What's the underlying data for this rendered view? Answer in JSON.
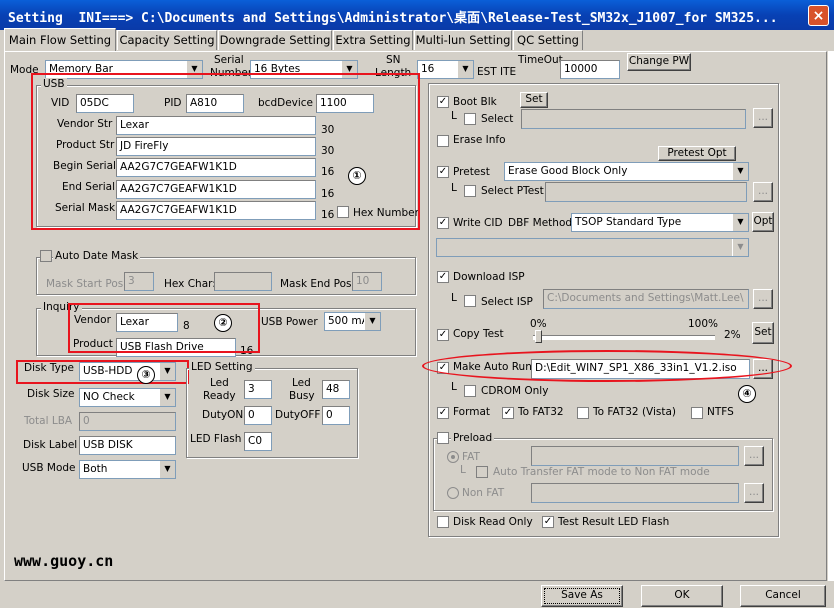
{
  "window": {
    "title": "Setting  INI===> C:\\Documents and Settings\\Administrator\\桌面\\Release-Test_SM32x_J1007_for SM325...",
    "close_label": "×"
  },
  "tabs": [
    "Main Flow Setting",
    "Capacity Setting",
    "Downgrade Setting",
    "Extra Setting",
    "Multi-lun Setting",
    "QC Setting"
  ],
  "top": {
    "mode_label": "Mode",
    "mode_value": "Memory Bar",
    "serial_label_1": "Serial",
    "serial_label_2": "Number",
    "serial_value": "16 Bytes",
    "sn_label_1": "SN",
    "sn_label_2": "Length",
    "sn_value": "16",
    "est_label": "EST ITEM",
    "timeout_label": "TimeOut",
    "timeout_value": "10000",
    "change_pw": "Change PW"
  },
  "usb": {
    "title": "USB",
    "vid_label": "VID",
    "vid": "05DC",
    "pid_label": "PID",
    "pid": "A810",
    "bcd_label": "bcdDevice",
    "bcd": "1100",
    "vendor_label": "Vendor Str",
    "vendor": "Lexar",
    "vendor_len": "30",
    "product_label": "Product Str",
    "product": "JD FireFly",
    "product_len": "30",
    "begin_label": "Begin Serial",
    "begin": "AA2G7C7GEAFW1K1D",
    "begin_len": "16",
    "end_label": "End Serial",
    "end": "AA2G7C7GEAFW1K1D",
    "end_len": "16",
    "mask_label": "Serial Mask",
    "mask": "AA2G7C7GEAFW1K1D",
    "mask_len": "16",
    "hex_number": "Hex Number"
  },
  "autodate": {
    "label": "Auto Date Mask",
    "mask_start": "Mask Start Pos:",
    "mask_start_val": "3",
    "hex_char": "Hex Char:",
    "hex_char_val": "",
    "mask_end": "Mask End Pos:",
    "mask_end_val": "10"
  },
  "inquiry": {
    "title": "Inquiry",
    "vendor_label": "Vendor",
    "vendor": "Lexar",
    "vendor_len": "8",
    "product_label": "Product",
    "product": "USB Flash Drive",
    "product_len": "16",
    "usb_power_label": "USB Power",
    "usb_power": "500 mA"
  },
  "disk": {
    "type_label": "Disk Type",
    "type": "USB-HDD",
    "size_label": "Disk Size",
    "size": "NO Check",
    "lba_label": "Total LBA",
    "lba": "0",
    "disk_label_label": "Disk Label",
    "disk_label": "USB DISK",
    "mode_label": "USB Mode",
    "mode": "Both"
  },
  "led": {
    "title": "LED Setting",
    "ready_1": "Led",
    "ready_2": "Ready",
    "ready": "3",
    "busy_1": "Led",
    "busy_2": "Busy",
    "busy": "48",
    "dutyon_label": "DutyON",
    "dutyon": "0",
    "dutyoff_label": "DutyOFF",
    "dutyoff": "0",
    "flash_label": "LED Flash",
    "flash": "C0"
  },
  "right": {
    "boot_blk": "Boot Blk",
    "set": "Set",
    "select": "Select",
    "browse": "...",
    "erase_info": "Erase Info",
    "pretest_opt": "Pretest Opt",
    "pretest": "Pretest",
    "pretest_value": "Erase Good Block Only",
    "select_ptest": "Select PTest",
    "write_cid": "Write CID",
    "dbf_method": "DBF Method",
    "dbf_value": "TSOP Standard Type",
    "opt": "Opt",
    "download_isp": "Download ISP",
    "select_isp": "Select ISP",
    "isp_path": "C:\\Documents and Settings\\Matt.Lee\\",
    "copy_test": "Copy Test",
    "pct0": "0%",
    "pct100": "100%",
    "pct_val": "2%",
    "copy_set": "Set",
    "make_auto_run": "Make Auto Run",
    "auto_run_path": "D:\\Edit_WIN7_SP1_X86_33in1_V1.2.iso",
    "cdrom_only": "CDROM Only",
    "format": "Format",
    "to_fat32": "To FAT32",
    "to_fat32_vista": "To FAT32 (Vista)",
    "ntfs": "NTFS",
    "preload": "Preload",
    "fat": "FAT",
    "auto_transfer": "Auto Transfer FAT mode to Non FAT mode",
    "non_fat": "Non FAT",
    "disk_read_only": "Disk Read Only",
    "test_result_led": "Test Result LED Flash",
    "check": "✓"
  },
  "annotations": [
    "①",
    "②",
    "③",
    "④"
  ],
  "watermark": "www.guoy.cn",
  "footer": {
    "save_as": "Save As",
    "ok": "OK",
    "cancel": "Cancel"
  }
}
